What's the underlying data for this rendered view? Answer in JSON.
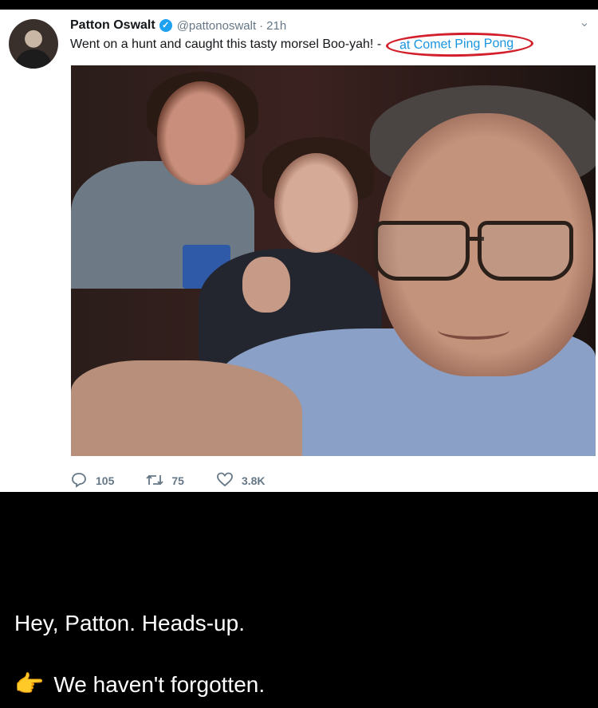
{
  "tweet": {
    "author_name": "Patton Oswalt",
    "handle": "@pattonoswalt",
    "separator": "·",
    "time": "21h",
    "text": "Went on a hunt and caught this tasty morsel  Boo-yah! -",
    "location": "at Comet Ping Pong",
    "actions": {
      "replies": "105",
      "retweets": "75",
      "likes": "3.8K"
    }
  },
  "caption": {
    "line1": "Hey, Patton.  Heads-up.",
    "line2": "We haven't forgotten."
  },
  "colors": {
    "circle_annotation": "#d21f2b",
    "link": "#1b95e0",
    "verified": "#1da1f2"
  },
  "icons": [
    "verified-badge-icon",
    "chevron-down-icon",
    "reply-icon",
    "retweet-icon",
    "like-icon",
    "pointing-hand-icon"
  ]
}
